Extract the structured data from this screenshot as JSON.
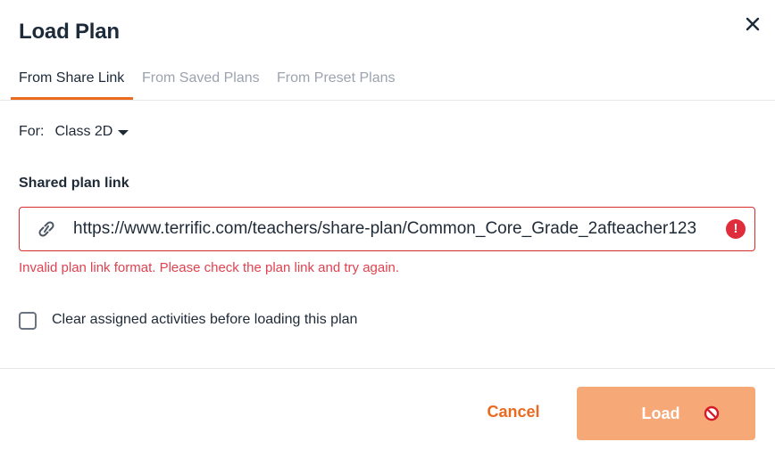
{
  "dialog": {
    "title": "Load Plan",
    "close_icon": "close-icon"
  },
  "tabs": [
    {
      "label": "From Share Link",
      "active": true
    },
    {
      "label": "From Saved Plans",
      "active": false
    },
    {
      "label": "From Preset Plans",
      "active": false
    }
  ],
  "for": {
    "label": "For:",
    "value": "Class 2D",
    "icon": "caret-down-icon"
  },
  "link_field": {
    "label": "Shared plan link",
    "value": "https://www.terrific.com/teachers/share-plan/Common_Core_Grade_2afteacher123",
    "leading_icon": "link-icon",
    "trailing_icon": "error-icon",
    "error_glyph": "!",
    "error_message": "Invalid plan link format. Please check the plan link and try again."
  },
  "clear_option": {
    "label": "Clear assigned activities before loading this plan",
    "checked": false
  },
  "footer": {
    "cancel_label": "Cancel",
    "load_label": "Load",
    "load_icon": "not-allowed-icon"
  },
  "colors": {
    "accent": "#ea6a1f",
    "load_disabled_bg": "#f7a877",
    "error": "#e0424f",
    "text": "#1f2a37"
  }
}
